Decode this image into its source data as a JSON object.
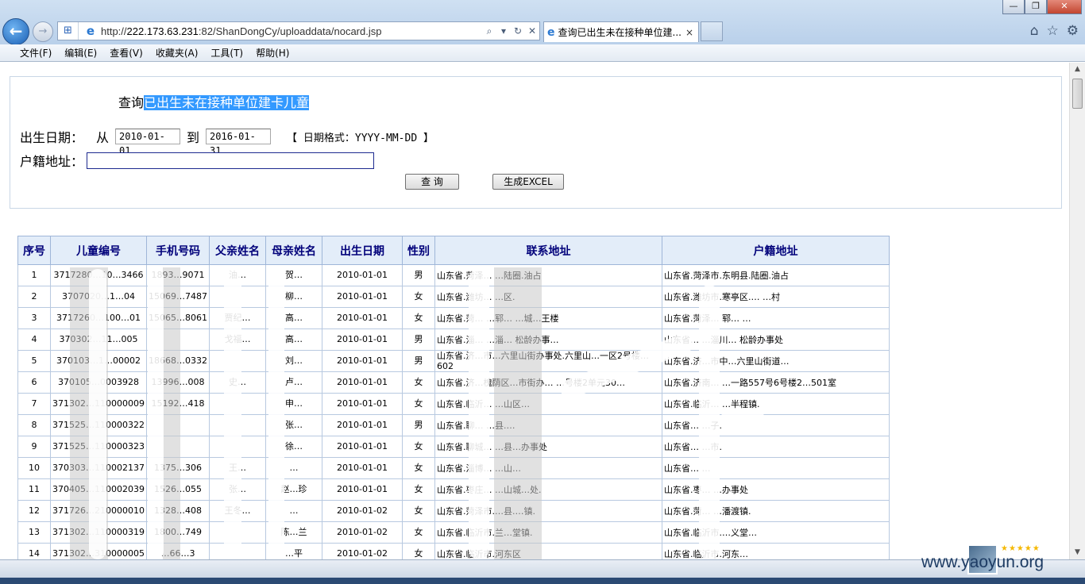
{
  "browser": {
    "url_prefix": "http://",
    "url_host": "222.173.63.231",
    "url_rest": ":82/ShanDongCy/uploaddata/nocard.jsp",
    "tab_title": "查询已出生未在接种单位建...",
    "tab_close": "×",
    "minimize": "—",
    "maximize": "❐",
    "close": "✕"
  },
  "menu": [
    "文件(F)",
    "编辑(E)",
    "查看(V)",
    "收藏夹(A)",
    "工具(T)",
    "帮助(H)"
  ],
  "query": {
    "title_prefix": "查询",
    "title_highlight": "已出生未在接种单位建卡儿童",
    "birth_label": "出生日期：",
    "from_label": "从",
    "date_from": "2010-01-01",
    "to_label": "到",
    "date_to": "2016-01-31",
    "format_hint": "【 日期格式：YYYY-MM-DD 】",
    "address_label": "户籍地址：",
    "address_value": "",
    "search_button": "查 询",
    "excel_button": "生成EXCEL"
  },
  "table": {
    "headers": [
      "序号",
      "儿童编号",
      "手机号码",
      "父亲姓名",
      "母亲姓名",
      "出生日期",
      "性别",
      "联系地址",
      "户籍地址"
    ],
    "rows": [
      [
        "1",
        "3717280…10…3466",
        "1893…9071",
        "油…",
        "贺…",
        "2010-01-01",
        "男",
        "山东省.菏泽…  …陆圈.油占",
        "山东省.菏泽市.东明县.陆圈.油占"
      ],
      [
        "2",
        "3707020…1…04",
        "15069…7487",
        "",
        "柳…",
        "2010-01-01",
        "女",
        "山东省.潍坊…  …区.",
        "山东省.潍坊市.寒亭区.…  …村"
      ],
      [
        "3",
        "3717260…100…01",
        "15065…8061",
        "贾纪…",
        "高…",
        "2010-01-01",
        "女",
        "山东省.菏…  …郓…  …城…王楼",
        "山东省.菏泽…  郓…  …"
      ],
      [
        "4",
        "370302…11…005",
        "",
        "戈福…",
        "高…",
        "2010-01-01",
        "男",
        "山东省.淄…  …淄…  松龄办事…",
        "山东省…  …淄川…  松龄办事处"
      ],
      [
        "5",
        "370103…1…00002",
        "18668…0332",
        "",
        "刘…",
        "2010-01-01",
        "男",
        "山东省.济…市…六里山街办事处.六里山…一区2号楼…602",
        "山东省.济…市中…六里山街道…"
      ],
      [
        "6",
        "370105…0003928",
        "13996…008",
        "史…",
        "卢…",
        "2010-01-01",
        "女",
        "山东省.济…槐荫区…市街办…  …号楼2单元30…",
        "山东省.济南…  …一路557号6号楼2…501室"
      ],
      [
        "7",
        "371302…110000009",
        "15192…418",
        "",
        "申…",
        "2010-01-01",
        "女",
        "山东省.临沂…  …山区…",
        "山东省.临沂…  …半程镇."
      ],
      [
        "8",
        "371525…110000322",
        "",
        "",
        "张…",
        "2010-01-01",
        "男",
        "山东省.聊…  …县.…",
        "山东省…  …子."
      ],
      [
        "9",
        "371525…110000323",
        "",
        "",
        "徐…",
        "2010-01-01",
        "女",
        "山东省.聊城…  …县…办事处",
        "山东省…  …市."
      ],
      [
        "10",
        "370303…110002137",
        "1375…306",
        "王…",
        "…",
        "2010-01-01",
        "女",
        "山东省.淄博…  …山…",
        "山东省…  …"
      ],
      [
        "11",
        "370405…110002039",
        "1526…055",
        "张…",
        "赵…珍",
        "2010-01-01",
        "女",
        "山东省.枣庄…  …山城…处.",
        "山东省.枣…  …办事处"
      ],
      [
        "12",
        "371726…210000010",
        "1328…408",
        "王冬…",
        "…",
        "2010-01-02",
        "女",
        "山东省.菏泽市.…县.…镇.",
        "山东省.菏…  …潘渡镇."
      ],
      [
        "13",
        "371302…110000319",
        "1800…749",
        "",
        "陈…兰",
        "2010-01-02",
        "女",
        "山东省.临沂市.兰…堂镇.",
        "山东省.临沂市.…义堂…"
      ],
      [
        "14",
        "371302…310000005",
        "…66…3",
        "",
        "…平",
        "2010-01-02",
        "女",
        "山东省.临沂市.河东区",
        "山东省.临沂市.河东…"
      ]
    ]
  },
  "watermark": {
    "site": "www.yaoyun.org",
    "stars": "★★★★★"
  }
}
